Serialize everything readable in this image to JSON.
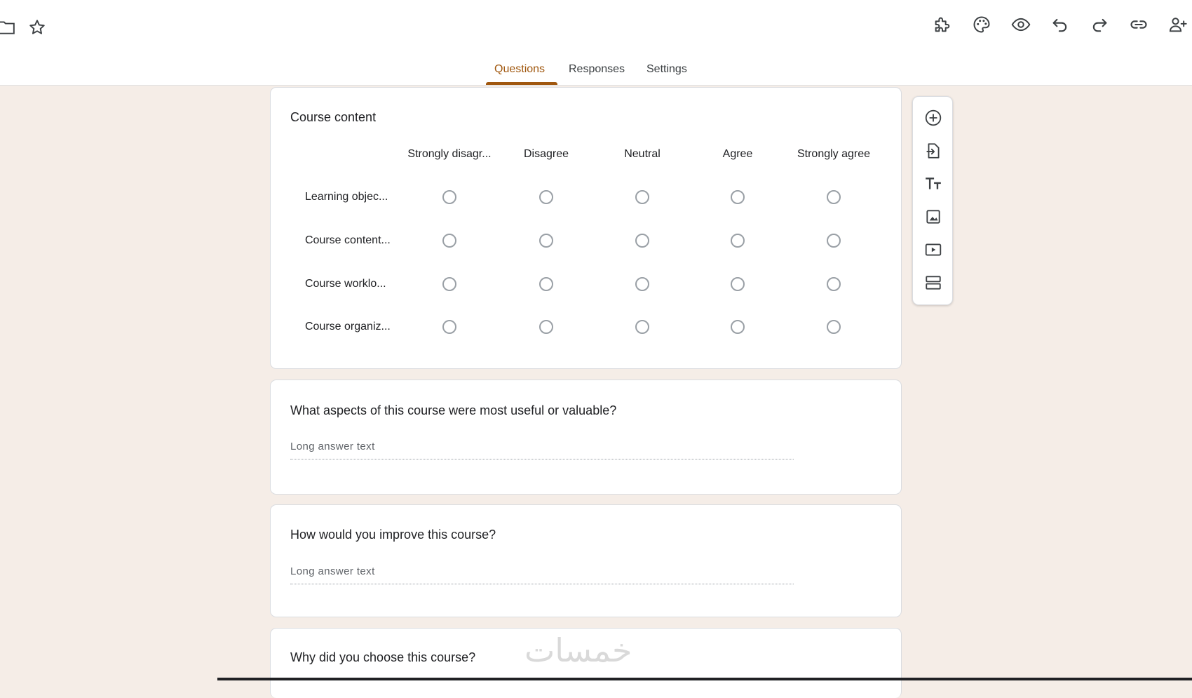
{
  "header": {
    "tabs": [
      {
        "label": "Questions",
        "active": true
      },
      {
        "label": "Responses",
        "active": false
      },
      {
        "label": "Settings",
        "active": false
      }
    ],
    "left_icons": [
      "folder-icon",
      "star-icon"
    ],
    "right_icons": [
      "addon-icon",
      "palette-icon",
      "preview-icon",
      "undo-icon",
      "redo-icon",
      "link-icon",
      "add-collaborator-icon"
    ]
  },
  "grid_question": {
    "title": "Course content",
    "columns": [
      "Strongly disagr...",
      "Disagree",
      "Neutral",
      "Agree",
      "Strongly agree"
    ],
    "rows": [
      "Learning objec...",
      "Course content...",
      "Course worklo...",
      "Course organiz..."
    ]
  },
  "questions": [
    {
      "title": "What aspects of this course were most useful or valuable?",
      "hint": "Long answer text"
    },
    {
      "title": "How would you improve this course?",
      "hint": "Long answer text"
    },
    {
      "title": "Why did you choose this course?"
    }
  ],
  "side_toolbar": [
    "add-question-icon",
    "import-questions-icon",
    "add-title-icon",
    "add-image-icon",
    "add-video-icon",
    "add-section-icon"
  ],
  "watermark": "خمسات",
  "colors": {
    "accent": "#a0570e",
    "background": "#f5ede7"
  }
}
